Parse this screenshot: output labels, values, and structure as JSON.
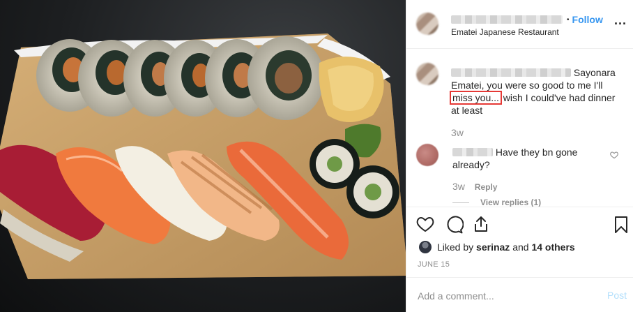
{
  "post": {
    "location": "Ematei Japanese Restaurant",
    "follow_label": "Follow",
    "separator": "•",
    "more_icon": "more-horizontal-icon",
    "more_glyph": "..."
  },
  "comments": [
    {
      "text_before": "Sayonara Ematei, you were so good to me I'll",
      "highlight": "miss you...",
      "text_after": "wish I could've had dinner at least",
      "time": "3w"
    },
    {
      "text": "Have they bn gone already?",
      "time": "3w",
      "reply_label": "Reply",
      "view_replies": "View replies (1)"
    }
  ],
  "actions": {
    "icons": [
      "heart-icon",
      "comment-icon",
      "share-icon",
      "bookmark-icon"
    ]
  },
  "likes": {
    "prefix": "Liked by",
    "user": "serinaz",
    "middle": "and",
    "others": "14 others"
  },
  "date": "JUNE 15",
  "comment_box": {
    "placeholder": "Add a comment...",
    "post_label": "Post"
  },
  "colors": {
    "link_blue": "#3897f0",
    "post_disabled": "#b2dffc",
    "highlight_box": "#e53935",
    "muted": "#8e8e8e"
  }
}
